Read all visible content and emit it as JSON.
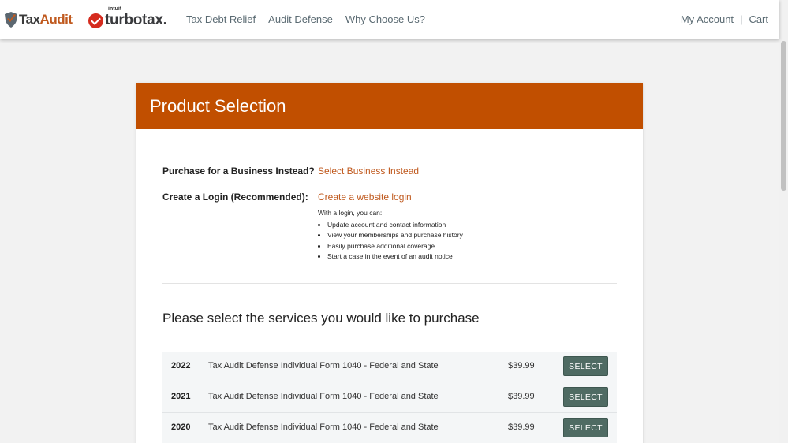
{
  "brand": {
    "taxaudit_prefix": "Tax",
    "taxaudit_suffix": "Audit",
    "turbotax_intuit": "intuit",
    "turbotax_name": "turbotax."
  },
  "nav": {
    "items": [
      {
        "label": "Tax Debt Relief"
      },
      {
        "label": "Audit Defense"
      },
      {
        "label": "Why Choose Us?"
      }
    ],
    "my_account": "My Account",
    "separator": "|",
    "cart": "Cart"
  },
  "page": {
    "title": "Product Selection"
  },
  "options": {
    "business_label": "Purchase for a Business Instead?",
    "business_link": "Select Business Instead",
    "login_label": "Create a Login (Recommended):",
    "login_link": "Create a website login",
    "login_intro": "With a login, you can:",
    "login_benefits": [
      "Update account and contact information",
      "View your memberships and purchase history",
      "Easily purchase additional coverage",
      "Start a case in the event of an audit notice"
    ]
  },
  "services": {
    "heading": "Please select the services you would like to purchase",
    "products": [
      {
        "year": "2022",
        "description": "Tax Audit Defense Individual Form 1040 - Federal and State",
        "price": "$39.99",
        "button": "SELECT"
      },
      {
        "year": "2021",
        "description": "Tax Audit Defense Individual Form 1040 - Federal and State",
        "price": "$39.99",
        "button": "SELECT"
      },
      {
        "year": "2020",
        "description": "Tax Audit Defense Individual Form 1040 - Federal and State",
        "price": "$39.99",
        "button": "SELECT"
      }
    ]
  },
  "colors": {
    "header_orange": "#c14f00",
    "link_orange": "#c05a1f",
    "select_button": "#4f6b63",
    "turbotax_red": "#d52b1e"
  }
}
